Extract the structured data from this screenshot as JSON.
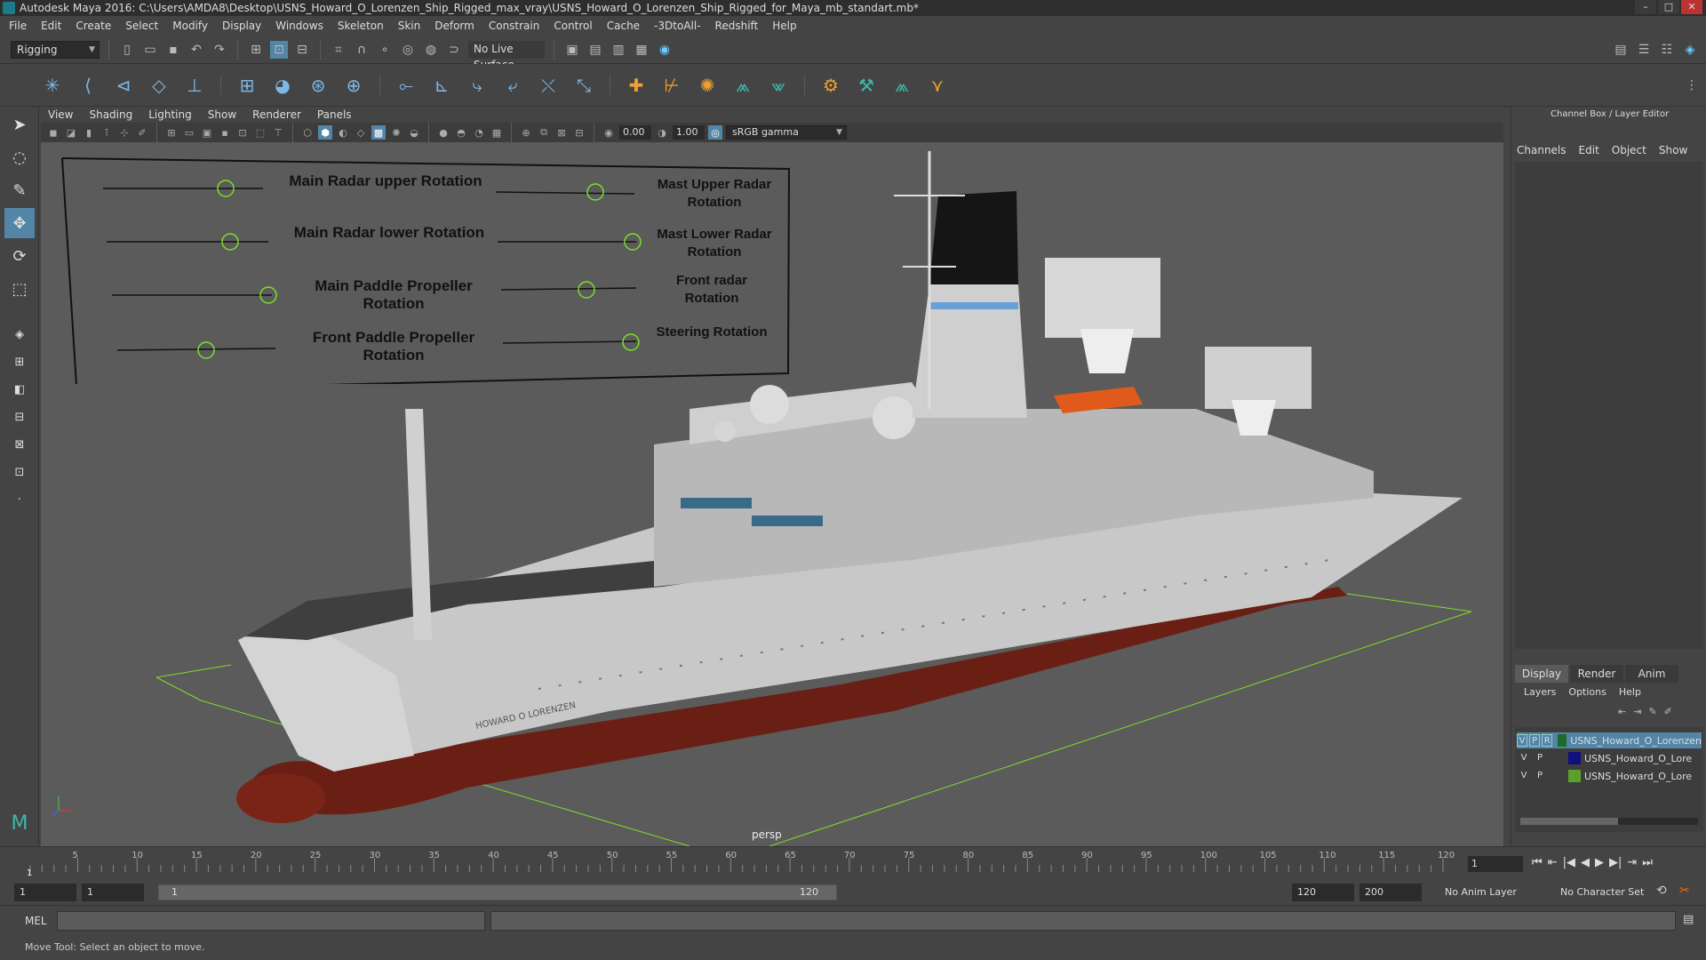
{
  "window": {
    "title": "Autodesk Maya 2016: C:\\Users\\AMDA8\\Desktop\\USNS_Howard_O_Lorenzen_Ship_Rigged_max_vray\\USNS_Howard_O_Lorenzen_Ship_Rigged_for_Maya_mb_standart.mb*"
  },
  "menubar": {
    "items": [
      "File",
      "Edit",
      "Create",
      "Select",
      "Modify",
      "Display",
      "Windows",
      "Skeleton",
      "Skin",
      "Deform",
      "Constrain",
      "Control",
      "Cache",
      "-3DtoAll-",
      "Redshift",
      "Help"
    ]
  },
  "statusline": {
    "mode": "Rigging",
    "live_surface": "No Live Surface"
  },
  "panel": {
    "menus": [
      "View",
      "Shading",
      "Lighting",
      "Show",
      "Renderer",
      "Panels"
    ],
    "field1": "0.00",
    "field2": "1.00",
    "colorspace": "sRGB gamma",
    "camera": "persp"
  },
  "controls": {
    "main_radar_upper": "Main Radar upper Rotation",
    "main_radar_lower": "Main Radar lower Rotation",
    "main_paddle": "Main Paddle Propeller Rotation",
    "front_paddle": "Front Paddle Propeller Rotation",
    "mast_upper": "Mast Upper Radar Rotation",
    "mast_lower": "Mast Lower Radar Rotation",
    "front_radar": "Front radar Rotation",
    "steering": "Steering Rotation"
  },
  "ship": {
    "name_on_hull": "HOWARD O LORENZEN"
  },
  "channelbox": {
    "title": "Channel Box / Layer Editor",
    "menus": [
      "Channels",
      "Edit",
      "Object",
      "Show"
    ]
  },
  "layereditor": {
    "tabs": [
      "Display",
      "Render",
      "Anim"
    ],
    "menus": [
      "Layers",
      "Options",
      "Help"
    ],
    "layers": [
      {
        "v": "V",
        "p": "P",
        "r": "R",
        "name": "USNS_Howard_O_Lorenzen",
        "color": "#1b6b2a",
        "selected": true
      },
      {
        "v": "V",
        "p": "P",
        "r": "",
        "name": "USNS_Howard_O_Lore",
        "color": "#101080",
        "selected": false
      },
      {
        "v": "V",
        "p": "P",
        "r": "",
        "name": "USNS_Howard_O_Lore",
        "color": "#5aa02a",
        "selected": false
      }
    ]
  },
  "timeline": {
    "ticks": [
      "5",
      "10",
      "15",
      "20",
      "25",
      "30",
      "35",
      "40",
      "45",
      "50",
      "55",
      "60",
      "65",
      "70",
      "75",
      "80",
      "85",
      "90",
      "95",
      "100",
      "105",
      "110",
      "115",
      "120"
    ],
    "current_frame": "1",
    "marker": "1"
  },
  "range": {
    "start": "1",
    "anim_start": "1",
    "slider_start": "1",
    "slider_end": "120",
    "end": "120",
    "anim_end": "200",
    "anim_layer": "No Anim Layer",
    "char_set": "No Character Set"
  },
  "mel": {
    "label": "MEL"
  },
  "status": {
    "help": "Move Tool: Select an object to move."
  }
}
